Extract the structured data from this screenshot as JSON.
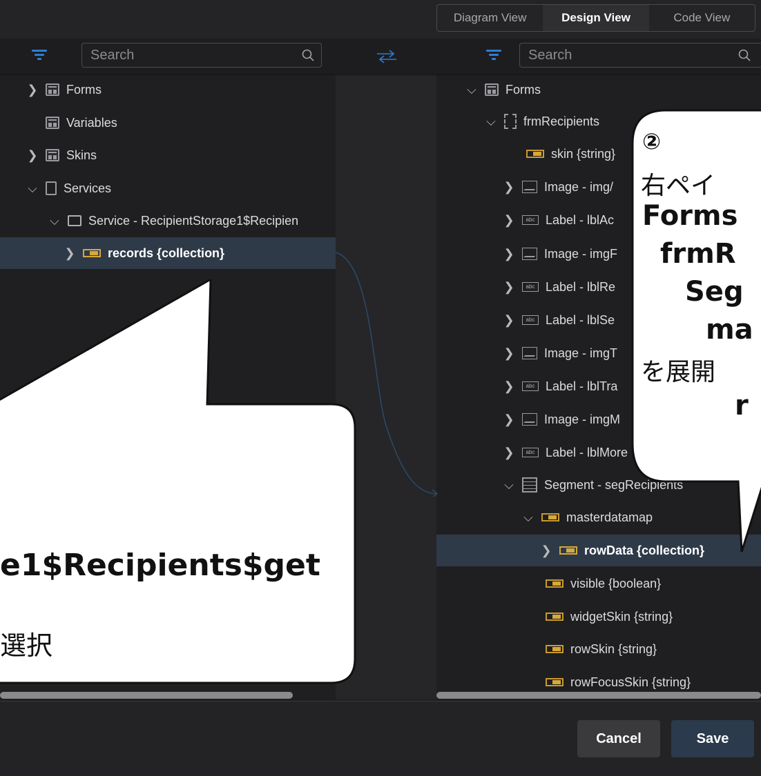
{
  "tabs": [
    {
      "label": "Diagram View",
      "active": false
    },
    {
      "label": "Design View",
      "active": true
    },
    {
      "label": "Code View",
      "active": false
    }
  ],
  "left_pane": {
    "search_placeholder": "Search",
    "items": [
      {
        "label": "Forms",
        "icon": "forms-icon",
        "expanded": false
      },
      {
        "label": "Variables",
        "icon": "forms-icon"
      },
      {
        "label": "Skins",
        "icon": "forms-icon",
        "expanded": false
      },
      {
        "label": "Services",
        "icon": "service-icon",
        "expanded": true
      },
      {
        "label": "Service - RecipientStorage1$Recipien",
        "icon": "folder-icon",
        "expanded": true
      },
      {
        "label": "records {collection}",
        "icon": "collection-icon",
        "selected": true
      }
    ]
  },
  "right_pane": {
    "search_placeholder": "Search",
    "items": [
      {
        "label": "Forms"
      },
      {
        "label": "frmRecipients"
      },
      {
        "label": "skin {string}"
      },
      {
        "label": "Image - img/"
      },
      {
        "label": "Label - lblAc"
      },
      {
        "label": "Image - imgF"
      },
      {
        "label": "Label - lblRe"
      },
      {
        "label": "Label - lblSe"
      },
      {
        "label": "Image - imgT"
      },
      {
        "label": "Label - lblTra"
      },
      {
        "label": "Image - imgM"
      },
      {
        "label": "Label - lblMore"
      },
      {
        "label": "Segment - segRecipients"
      },
      {
        "label": "masterdatamap"
      },
      {
        "label": "rowData {collection}",
        "selected": true
      },
      {
        "label": "visible {boolean}"
      },
      {
        "label": "widgetSkin {string}"
      },
      {
        "label": "rowSkin {string}"
      },
      {
        "label": "rowFocusSkin {string}"
      }
    ]
  },
  "buttons": {
    "cancel": "Cancel",
    "save": "Save"
  },
  "callout_left": {
    "line1": "e1$Recipients$get",
    "line2": "選択"
  },
  "callout_right": {
    "num": "②",
    "l1": "右ペイ",
    "l2": "Forms",
    "l3": "frmR",
    "l4": "Seg",
    "l5": "ma",
    "l6": "を展開",
    "l7": "r"
  },
  "colors": {
    "accent": "#2d7dd2",
    "collection": "#d6a93a",
    "selected_row": "#2f3a48",
    "background": "#1f1f21"
  }
}
